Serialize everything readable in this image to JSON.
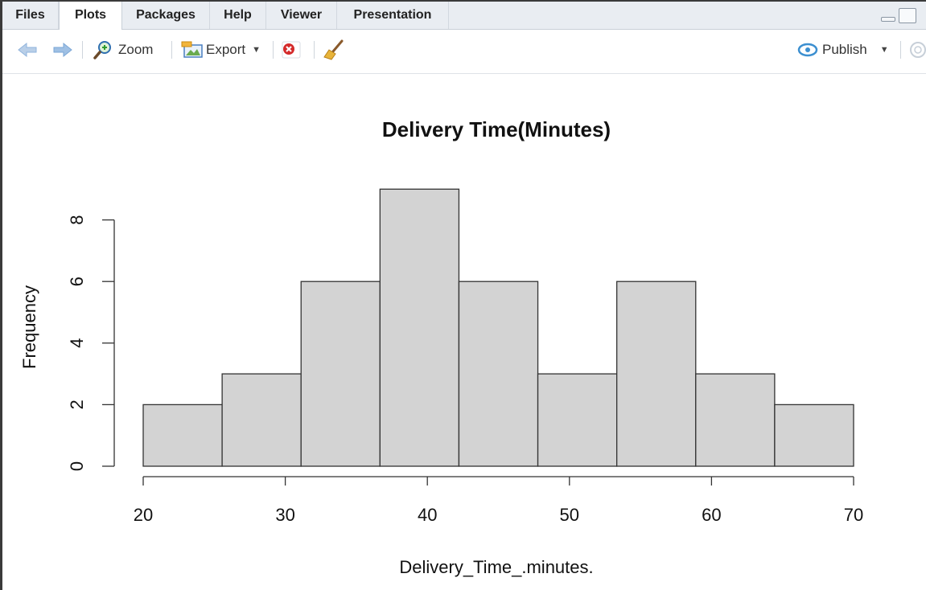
{
  "tabs": [
    {
      "label": "Files",
      "active": false
    },
    {
      "label": "Plots",
      "active": true
    },
    {
      "label": "Packages",
      "active": false
    },
    {
      "label": "Help",
      "active": false
    },
    {
      "label": "Viewer",
      "active": false
    },
    {
      "label": "Presentation",
      "active": false
    }
  ],
  "toolbar": {
    "zoom_label": "Zoom",
    "export_label": "Export",
    "publish_label": "Publish",
    "icons": [
      "back-arrow-icon",
      "forward-arrow-icon",
      "zoom-icon",
      "export-icon",
      "remove-plot-icon",
      "broom-icon",
      "publish-icon",
      "refresh-icon"
    ]
  },
  "colors": {
    "tabbar_bg": "#e9edf2",
    "bar_fill": "#d3d3d3",
    "bar_stroke": "#333333",
    "arrow_blue": "#8fb3dc",
    "publish_blue": "#3c8fd0"
  },
  "chart_data": {
    "type": "bar",
    "title": "Delivery Time(Minutes)",
    "xlabel": "Delivery_Time_.minutes.",
    "ylabel": "Frequency",
    "bins": [
      {
        "start": 20,
        "end": 25.5556,
        "count": 2
      },
      {
        "start": 25.5556,
        "end": 31.1111,
        "count": 3
      },
      {
        "start": 31.1111,
        "end": 36.6667,
        "count": 6
      },
      {
        "start": 36.6667,
        "end": 42.2222,
        "count": 9
      },
      {
        "start": 42.2222,
        "end": 47.7778,
        "count": 6
      },
      {
        "start": 47.7778,
        "end": 53.3333,
        "count": 3
      },
      {
        "start": 53.3333,
        "end": 58.8889,
        "count": 6
      },
      {
        "start": 58.8889,
        "end": 64.4444,
        "count": 3
      },
      {
        "start": 64.4444,
        "end": 70,
        "count": 2
      }
    ],
    "xlim": [
      20,
      70
    ],
    "ylim": [
      0,
      9
    ],
    "xticks": [
      20,
      30,
      40,
      50,
      60,
      70
    ],
    "yticks": [
      0,
      2,
      4,
      6,
      8
    ],
    "grid": false,
    "legend": "none"
  }
}
